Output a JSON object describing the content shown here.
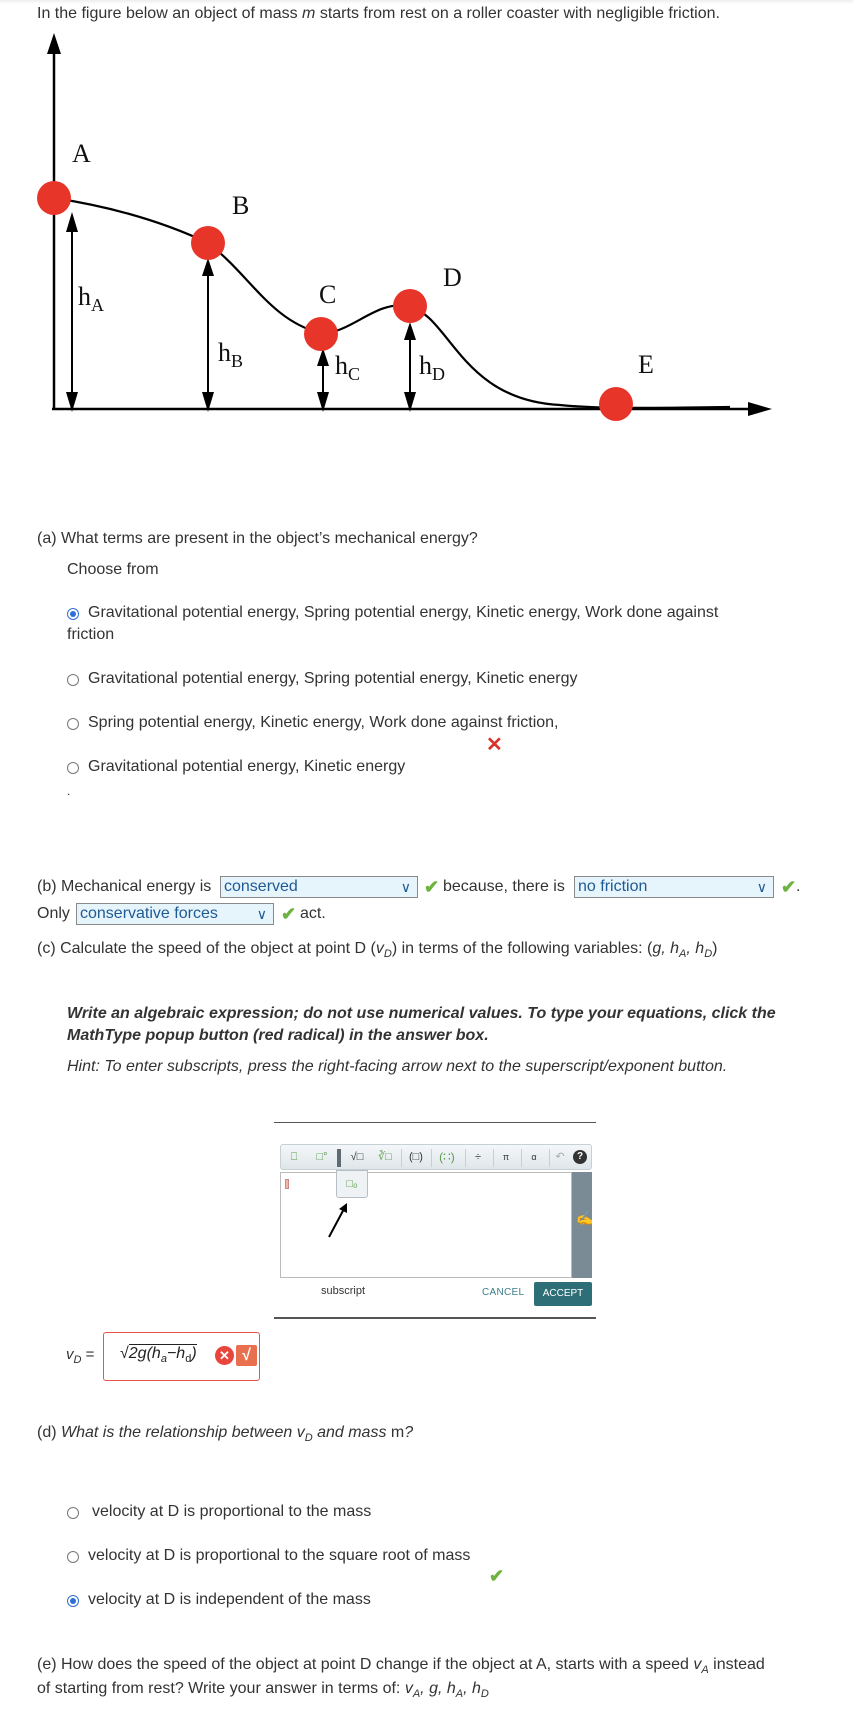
{
  "intro": {
    "pre": "In the figure below an object of mass ",
    "var": "m",
    "post": " starts from rest on a roller coaster with negligible friction."
  },
  "figure": {
    "points": [
      "A",
      "B",
      "C",
      "D",
      "E"
    ],
    "heights": [
      {
        "h": "h",
        "sub": "A"
      },
      {
        "h": "h",
        "sub": "B"
      },
      {
        "h": "h",
        "sub": "C"
      },
      {
        "h": "h",
        "sub": "D"
      }
    ],
    "ball_color": "#e8352a"
  },
  "part_a": {
    "question": "(a) What terms are present in the object’s mechanical energy?",
    "choose_from": "Choose from",
    "options": [
      {
        "line1": "Gravitational potential energy, Spring potential energy, Kinetic energy, Work done against",
        "line2": "friction",
        "selected": true
      },
      {
        "line1": "Gravitational potential energy, Spring potential energy, Kinetic energy",
        "selected": false
      },
      {
        "line1": "Spring potential energy, Kinetic energy, Work done against friction,",
        "selected": false
      },
      {
        "line1": "Gravitational potential energy, Kinetic energy",
        "selected": false
      }
    ],
    "feedback": "incorrect",
    "trailing_dot": "."
  },
  "part_b": {
    "prefix": "(b) Mechanical energy is",
    "select1": "conserved",
    "middle": "because, there is",
    "select2": "no friction",
    "period": ".",
    "only": "Only",
    "select3": "conservative forces",
    "act": "act.",
    "check": "✔"
  },
  "part_c": {
    "question_pre": "(c) Calculate the speed of the object at point D (",
    "question_var": "v",
    "question_var_sub": "D",
    "question_post": ") in terms of the following variables: (",
    "vars": "g, h",
    "instruction": "Write an algebraic expression; do not use numerical values. To type your equations, click the MathType popup button (red radical) in the answer box.",
    "hint": "Hint: To enter subscripts, press the right-facing arrow next to the superscript/exponent button.",
    "mathtype": {
      "toolbar": [
        "fraction",
        "superscript",
        "square-root",
        "nth-root",
        "parentheses",
        "matrix",
        "plus-minus",
        "pi",
        "alpha",
        "undo",
        "help"
      ],
      "popup_label": "subscript",
      "cancel": "CANCEL",
      "accept": "ACCEPT"
    },
    "answer_label": "v",
    "answer_label_sub": "D",
    "answer_eq": " =",
    "answer_value": "√2g(ha−hd)",
    "answer_status": "incorrect"
  },
  "part_d": {
    "question_pre": "(d) ",
    "question_italic": "What is the relationship between ",
    "var": "v",
    "var_sub": "D",
    "question_mid": " and mass ",
    "mass": "m",
    "q_end": "?",
    "options": [
      {
        "label": "velocity at D is proportional to the mass",
        "selected": false
      },
      {
        "label": "velocity at D is proportional to the square root of mass",
        "selected": false
      },
      {
        "label": "velocity at D is independent of the mass",
        "selected": true
      }
    ],
    "feedback": "correct"
  },
  "part_e": {
    "line1_pre": "(e) How does the speed of the object at point D change if the object at A, starts with a speed ",
    "line1_var": "v",
    "line1_sub": "A",
    "line1_post": " instead",
    "line2_pre": "of starting from rest? Write your answer in terms of: "
  }
}
